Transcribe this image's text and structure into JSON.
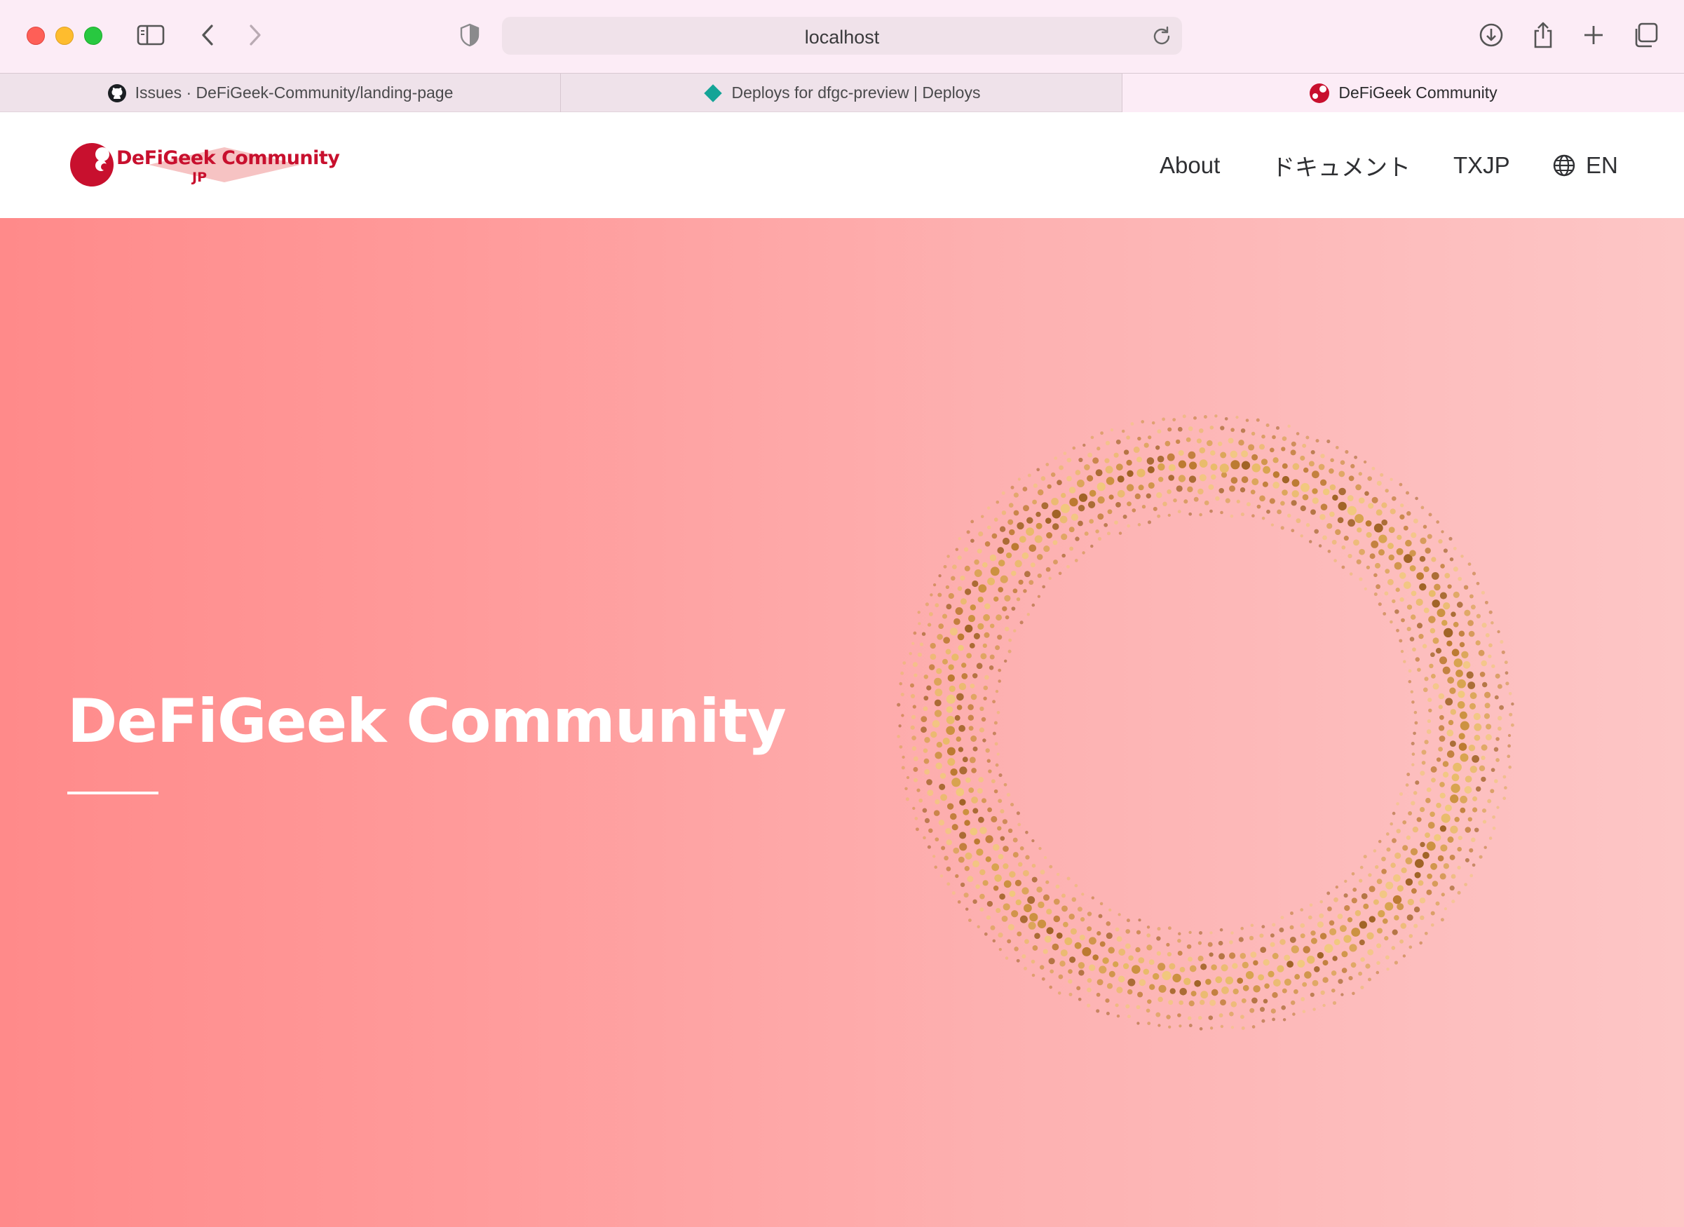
{
  "browser": {
    "url": "localhost",
    "tabs": [
      {
        "label": "Issues · DeFiGeek-Community/landing-page",
        "icon": "github-icon"
      },
      {
        "label": "Deploys for dfgc-preview | Deploys",
        "icon": "netlify-diamond-icon"
      },
      {
        "label": "DeFiGeek Community",
        "icon": "dfgc-logo-icon",
        "active": true
      }
    ]
  },
  "site": {
    "logo": {
      "name": "DeFiGeek Community",
      "sub": "JP"
    },
    "nav": {
      "about": "About",
      "docs": "ドキュメント",
      "txjp": "TXJP",
      "language": "EN"
    }
  },
  "hero": {
    "title": "DeFiGeek Community"
  },
  "colors": {
    "brand_red": "#c8102e",
    "hero_left": "#ff8a8a",
    "hero_right": "#fdc6c6",
    "ring_gold": "#c9923a"
  }
}
